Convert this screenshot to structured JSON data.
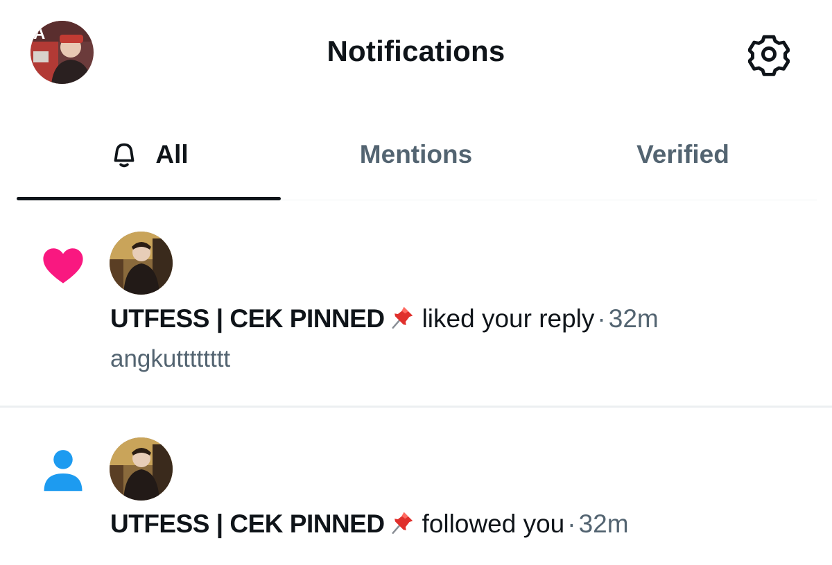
{
  "header": {
    "title": "Notifications",
    "profile_avatar_icon": "profile-avatar",
    "settings_icon": "gear-icon"
  },
  "tabs": [
    {
      "label": "All",
      "icon": "bell-icon",
      "selected": true
    },
    {
      "label": "Mentions",
      "selected": false
    },
    {
      "label": "Verified",
      "selected": false
    }
  ],
  "notifications": [
    {
      "type_icon": "heart-icon",
      "type_color": "#f91880",
      "actor": "UTFESS | CEK PINNED",
      "actor_emoji": "pushpin-icon",
      "action": "liked your reply",
      "separator": "·",
      "time": "32m",
      "preview": "angkutttttttt"
    },
    {
      "type_icon": "person-icon",
      "type_color": "#1d9bf0",
      "actor": "UTFESS | CEK PINNED",
      "actor_emoji": "pushpin-icon",
      "action": "followed you",
      "separator": "·",
      "time": "32m"
    }
  ],
  "colors": {
    "text_primary": "#0f1419",
    "text_secondary": "#536471",
    "like": "#f91880",
    "follow": "#1d9bf0"
  }
}
